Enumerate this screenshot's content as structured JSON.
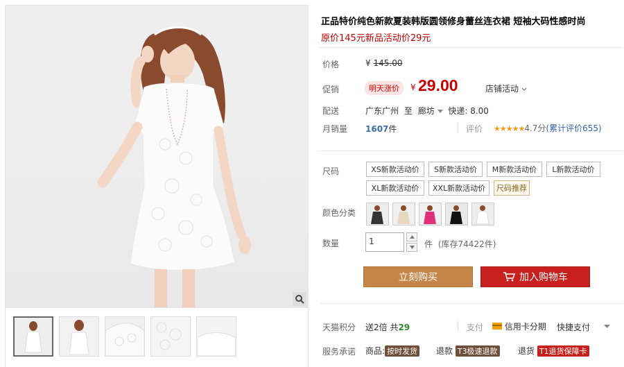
{
  "product": {
    "title": "正品特价纯色新款夏装韩版圆领修身蕾丝连衣裙 短袖大码性感时尚",
    "subtitle": "原价145元新品活动价29元"
  },
  "pricing": {
    "orig_label": "价格",
    "orig_currency": "¥",
    "orig_price": "145.00",
    "promo_label": "促销",
    "badge": "明天涨价",
    "currency": "¥",
    "price": "29.00",
    "store_promo": "店铺活动"
  },
  "shipping": {
    "label": "配送",
    "from": "广东广州",
    "to_word": "至",
    "to": "廊坊",
    "express": "快递: 8.00"
  },
  "sales": {
    "label": "月销量",
    "count": "1607",
    "unit": "件",
    "rating_label": "评价",
    "stars": "★★★★★",
    "score": "4.7分",
    "reviews": "(累计评价655)"
  },
  "size": {
    "label": "尺码",
    "options": [
      "XS新款活动价",
      "S新款活动价",
      "M新款活动价",
      "L新款活动价",
      "XL新款活动价",
      "XXL新款活动价"
    ],
    "recommend": "尺码推荐"
  },
  "color": {
    "label": "颜色分类"
  },
  "quantity": {
    "label": "数量",
    "value": "1",
    "unit": "件",
    "stock": "(库存74422件)"
  },
  "actions": {
    "buy": "立刻购买",
    "cart": "加入购物车"
  },
  "points": {
    "label": "天猫积分",
    "send": "送2倍 共",
    "amount": "29",
    "pay_label": "支付",
    "card": "信用卡分期",
    "quick": "快捷支付"
  },
  "service": {
    "label": "服务承诺",
    "goods": "商品:",
    "goods_tag": "按时发货",
    "refund": "退款",
    "refund_tag": "T3极速退款",
    "return": "退货",
    "return_tag": "T1退货保障卡"
  },
  "colors": {
    "price_red": "#c40000",
    "buy_btn": "#c6864a",
    "cart_btn": "#c8201e"
  }
}
